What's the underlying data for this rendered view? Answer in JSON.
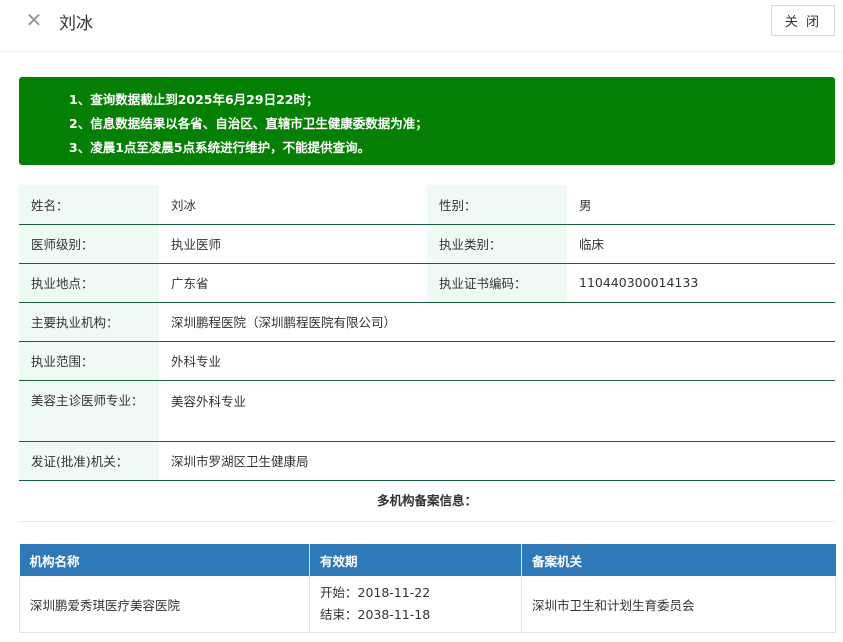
{
  "header": {
    "title": "刘冰",
    "close_label": "关 闭"
  },
  "notice": {
    "color": "#058005",
    "lines": [
      "1、查询数据截止到2025年6月29日22时；",
      "2、信息数据结果以各省、自治区、直辖市卫生健康委数据为准；",
      "3、凌晨1点至凌晨5点系统进行维护，不能提供查询。"
    ]
  },
  "info": {
    "name_label": "姓名：",
    "name": "刘冰",
    "gender_label": "性别：",
    "gender": "男",
    "level_label": "医师级别：",
    "level": "执业医师",
    "category_label": "执业类别：",
    "category": "临床",
    "location_label": "执业地点：",
    "location": "广东省",
    "cert_label": "执业证书编码：",
    "cert": "110440300014133",
    "org_label": "主要执业机构：",
    "org": "深圳鹏程医院（深圳鹏程医院有限公司）",
    "scope_label": "执业范围：",
    "scope": "外科专业",
    "beauty_label": "美容主诊医师专业：",
    "beauty": "美容外科专业",
    "issuer_label": "发证(批准)机关：",
    "issuer": "深圳市罗湖区卫生健康局"
  },
  "records": {
    "title": "多机构备案信息：",
    "header_color": "#2f79b9",
    "columns": [
      "机构名称",
      "有效期",
      "备案机关"
    ],
    "rows": [
      {
        "org": "深圳鹏爱秀琪医疗美容医院",
        "start": "开始：2018-11-22",
        "end": "结束：2038-11-18",
        "authority": "深圳市卫生和计划生育委员会"
      }
    ]
  }
}
